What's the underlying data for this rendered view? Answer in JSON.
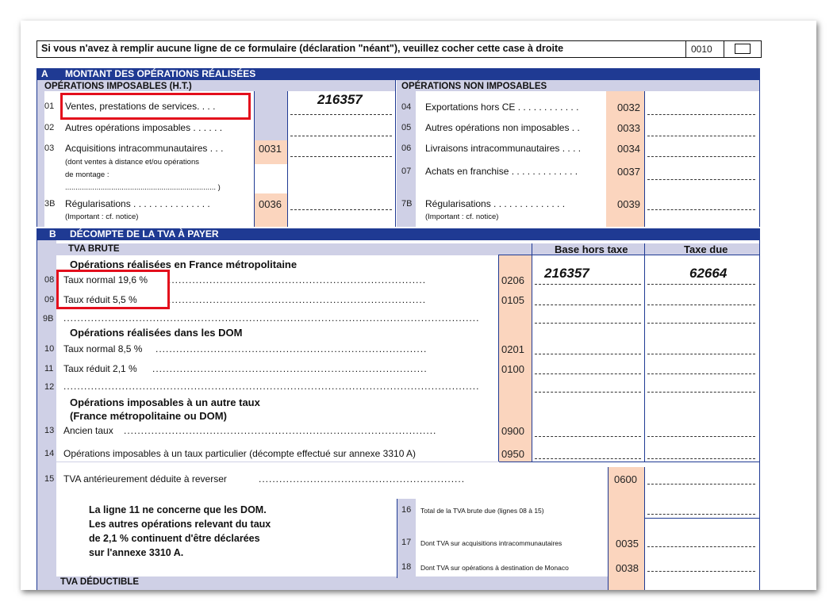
{
  "top_notice": {
    "text": "Si vous n'avez à remplir aucune ligne de ce formulaire (déclaration \"néant\"), veuillez cocher cette case à droite",
    "code": "0010"
  },
  "section_a": {
    "letter": "A",
    "title": "MONTANT DES OPÉRATIONS RÉALISÉES",
    "left_header": "OPÉRATIONS IMPOSABLES (H.T.)",
    "right_header": "OPÉRATIONS NON IMPOSABLES",
    "left_rows": [
      {
        "num": "01",
        "label": "Ventes, prestations de services. . . .",
        "code": "",
        "value": "216357"
      },
      {
        "num": "02",
        "label": "Autres opérations imposables . . . . . .",
        "code": "",
        "value": ""
      },
      {
        "num": "03",
        "label": "Acquisitions intracommunautaires . . .",
        "code": "0031",
        "value": "",
        "note1": "(dont ventes à distance et/ou opérations",
        "note2": "de montage :",
        "note3": "........................................................................ )"
      },
      {
        "num": "3B",
        "label": "Régularisations  . . . . . . . . . . . . . . .",
        "code": "0036",
        "value": "",
        "note1": "(Important : cf. notice)"
      }
    ],
    "right_rows": [
      {
        "num": "04",
        "label": "Exportations hors CE . . . . . . . . . . . .",
        "code": "0032"
      },
      {
        "num": "05",
        "label": "Autres opérations non imposables . .",
        "code": "0033"
      },
      {
        "num": "06",
        "label": "Livraisons intracommunautaires . . . .",
        "code": "0034"
      },
      {
        "num": "07",
        "label": "Achats en franchise . . . . . . . . . . . . .",
        "code": "0037"
      },
      {
        "num": "7B",
        "label": "Régularisations  . . . . . . . . . . . . . .",
        "code": "0039",
        "note1": "(Important : cf. notice)"
      }
    ]
  },
  "section_b": {
    "letter": "B",
    "title": "DÉCOMPTE DE LA TVA  À PAYER",
    "tva_brute": "TVA BRUTE",
    "col_base": "Base hors taxe",
    "col_tax": "Taxe due",
    "sub_metro": "Opérations réalisées en France métropolitaine",
    "sub_dom": "Opérations réalisées dans les DOM",
    "sub_autre1": "Opérations imposables à un autre taux",
    "sub_autre2": "(France métropolitaine ou DOM)",
    "rows": [
      {
        "num": "08",
        "label": "Taux normal 19,6 %",
        "code": "0206",
        "base": "216357",
        "tax": "62664"
      },
      {
        "num": "09",
        "label": "Taux réduit 5,5 %",
        "code": "0105",
        "base": "",
        "tax": ""
      },
      {
        "num": "9B",
        "label": "",
        "code": "",
        "base": "",
        "tax": ""
      },
      {
        "num": "10",
        "label": "Taux normal 8,5 %",
        "code": "0201",
        "base": "",
        "tax": ""
      },
      {
        "num": "11",
        "label": "Taux réduit 2,1 %",
        "code": "0100",
        "base": "",
        "tax": ""
      },
      {
        "num": "12",
        "label": "",
        "code": "",
        "base": "",
        "tax": ""
      },
      {
        "num": "13",
        "label": "Ancien taux",
        "code": "0900",
        "base": "",
        "tax": ""
      },
      {
        "num": "14",
        "label": "Opérations imposables à un taux particulier (décompte effectué sur annexe 3310 A)",
        "code": "0950",
        "base": "",
        "tax": ""
      }
    ],
    "row15": {
      "num": "15",
      "label": "TVA antérieurement déduite à reverser",
      "code": "0600"
    },
    "dom_note": [
      "La ligne 11 ne concerne que les DOM.",
      "Les autres opérations relevant du taux",
      "de 2,1 % continuent d'être déclarées",
      "sur l'annexe 3310 A."
    ],
    "row16": {
      "num": "16",
      "label": "Total de la TVA brute due (lignes 08 à 15)"
    },
    "row17": {
      "num": "17",
      "label": "Dont TVA sur acquisitions intracommunautaires",
      "code": "0035"
    },
    "row18": {
      "num": "18",
      "label": "Dont TVA sur opérations à destination de Monaco",
      "code": "0038"
    },
    "tva_deductible": "TVA DÉDUCTIBLE"
  },
  "colors": {
    "navy": "#1f3a93",
    "lavender": "#cfd0e6",
    "peach": "#fbd5be",
    "highlight": "#e30e1c"
  }
}
